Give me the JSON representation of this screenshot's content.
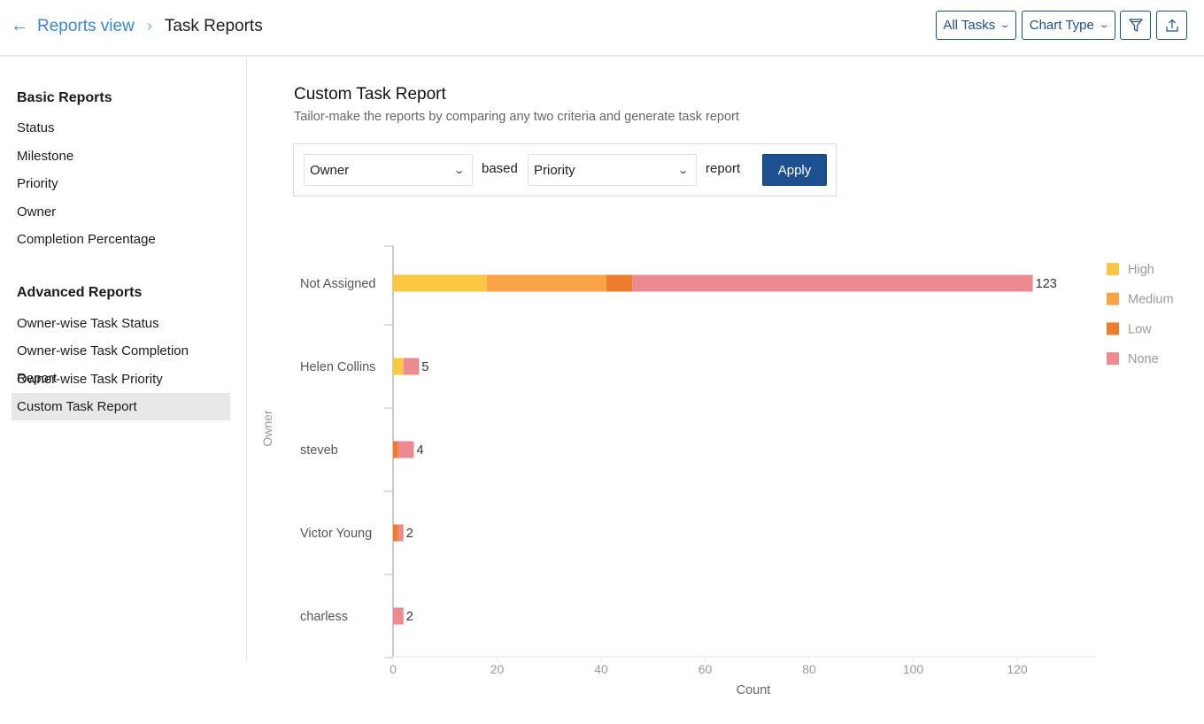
{
  "header": {
    "back_icon": "arrow-left-icon",
    "breadcrumb_link": "Reports view",
    "breadcrumb_separator_icon": "chevron-right-icon",
    "breadcrumb_current": "Task Reports",
    "all_tasks_label": "All Tasks",
    "chart_type_label": "Chart Type",
    "filter_icon": "filter-funnel-icon",
    "export_icon": "export-upload-icon"
  },
  "sidebar": {
    "basic_heading": "Basic Reports",
    "basic_items": [
      "Status",
      "Milestone",
      "Priority",
      "Owner",
      "Completion Percentage"
    ],
    "advanced_heading": "Advanced Reports",
    "advanced_items": [
      "Owner-wise Task Status",
      "Owner-wise Task Completion Report",
      "Owner-wise Task Priority",
      "Custom Task Report"
    ],
    "active_item": "Custom Task Report"
  },
  "main": {
    "title": "Custom Task Report",
    "subtitle": "Tailor-make the reports by comparing any two criteria and generate task report",
    "criteria": {
      "first_select": "Owner",
      "word_based": "based",
      "second_select": "Priority",
      "word_report": "report",
      "apply_label": "Apply"
    }
  },
  "colors": {
    "High": "#fcc843",
    "Medium": "#fba347",
    "Low": "#ed7d2d",
    "None": "#ec8a91",
    "accent": "#1d5090",
    "link": "#3d86d1"
  },
  "chart_data": {
    "type": "bar",
    "orientation": "horizontal",
    "stacked": true,
    "title": "",
    "xlabel": "Count",
    "ylabel": "Owner",
    "categories": [
      "Not Assigned",
      "Helen Collins",
      "steveb",
      "Victor Young",
      "charless"
    ],
    "series": [
      {
        "name": "High",
        "values": [
          18,
          2,
          0,
          0,
          0
        ]
      },
      {
        "name": "Medium",
        "values": [
          23,
          0,
          0,
          0,
          0
        ]
      },
      {
        "name": "Low",
        "values": [
          5,
          0,
          1,
          1,
          0
        ]
      },
      {
        "name": "None",
        "values": [
          77,
          3,
          3,
          1,
          2
        ]
      }
    ],
    "totals": [
      123,
      5,
      4,
      2,
      2
    ],
    "xlim": [
      0,
      132
    ],
    "xticks": [
      0,
      20,
      40,
      60,
      80,
      100,
      120
    ],
    "legend": "right",
    "grid": false
  }
}
